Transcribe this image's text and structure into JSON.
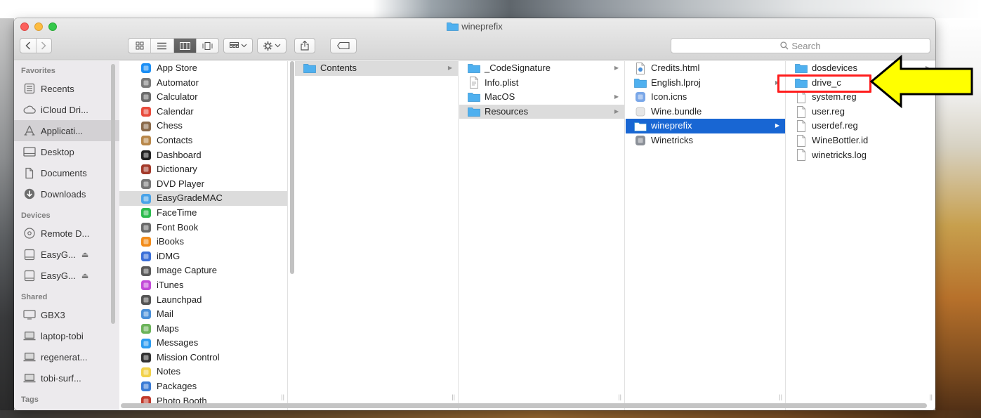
{
  "window": {
    "title": "wineprefix"
  },
  "toolbar": {
    "search_placeholder": "Search"
  },
  "sidebar": {
    "sections": {
      "favorites": "Favorites",
      "devices": "Devices",
      "shared": "Shared",
      "tags": "Tags"
    },
    "favorites": [
      {
        "label": "Recents",
        "icon": "recents-icon"
      },
      {
        "label": "iCloud Dri...",
        "icon": "cloud-icon"
      },
      {
        "label": "Applicati...",
        "icon": "applications-icon",
        "selected": true
      },
      {
        "label": "Desktop",
        "icon": "desktop-icon"
      },
      {
        "label": "Documents",
        "icon": "documents-icon"
      },
      {
        "label": "Downloads",
        "icon": "downloads-icon"
      }
    ],
    "devices": [
      {
        "label": "Remote D...",
        "icon": "remote-disc-icon"
      },
      {
        "label": "EasyG...",
        "icon": "disk-icon",
        "eject": "⏏"
      },
      {
        "label": "EasyG...",
        "icon": "disk-icon",
        "eject": "⏏"
      }
    ],
    "shared": [
      {
        "label": "GBX3",
        "icon": "display-icon"
      },
      {
        "label": "laptop-tobi",
        "icon": "computer-icon"
      },
      {
        "label": "regenerat...",
        "icon": "computer-icon"
      },
      {
        "label": "tobi-surf...",
        "icon": "computer-icon"
      }
    ]
  },
  "columns": {
    "applications": [
      {
        "label": "App Store",
        "icon_color": "#1c8ff5"
      },
      {
        "label": "Automator",
        "icon_color": "#7a7a7a"
      },
      {
        "label": "Calculator",
        "icon_color": "#6b6b6b"
      },
      {
        "label": "Calendar",
        "icon_color": "#e84b3c"
      },
      {
        "label": "Chess",
        "icon_color": "#8a6a4a"
      },
      {
        "label": "Contacts",
        "icon_color": "#b8874a"
      },
      {
        "label": "Dashboard",
        "icon_color": "#222222"
      },
      {
        "label": "Dictionary",
        "icon_color": "#a33a2a"
      },
      {
        "label": "DVD Player",
        "icon_color": "#777777"
      },
      {
        "label": "EasyGradeMAC",
        "icon_color": "#4aa3e8",
        "selected": true
      },
      {
        "label": "FaceTime",
        "icon_color": "#2dbb4e"
      },
      {
        "label": "Font Book",
        "icon_color": "#6a6a6a"
      },
      {
        "label": "iBooks",
        "icon_color": "#f28c1b"
      },
      {
        "label": "iDMG",
        "icon_color": "#3b6fd8"
      },
      {
        "label": "Image Capture",
        "icon_color": "#5a5a5a"
      },
      {
        "label": "iTunes",
        "icon_color": "#c34bd8"
      },
      {
        "label": "Launchpad",
        "icon_color": "#555555"
      },
      {
        "label": "Mail",
        "icon_color": "#4a90d9"
      },
      {
        "label": "Maps",
        "icon_color": "#6bb35a"
      },
      {
        "label": "Messages",
        "icon_color": "#2d9cf0"
      },
      {
        "label": "Mission Control",
        "icon_color": "#333333"
      },
      {
        "label": "Notes",
        "icon_color": "#f2d24a"
      },
      {
        "label": "Packages",
        "icon_color": "#3a7bd5"
      },
      {
        "label": "Photo Booth",
        "icon_color": "#c0392b"
      }
    ],
    "app_contents": [
      {
        "label": "Contents",
        "type": "folder",
        "selected": true,
        "has_children": true
      }
    ],
    "contents": [
      {
        "label": "_CodeSignature",
        "type": "folder",
        "has_children": true
      },
      {
        "label": "Info.plist",
        "type": "plist"
      },
      {
        "label": "MacOS",
        "type": "folder",
        "has_children": true
      },
      {
        "label": "Resources",
        "type": "folder",
        "selected": true,
        "has_children": true
      }
    ],
    "resources": [
      {
        "label": "Credits.html",
        "type": "html"
      },
      {
        "label": "English.lproj",
        "type": "folder",
        "has_children": true
      },
      {
        "label": "Icon.icns",
        "type": "icns"
      },
      {
        "label": "Wine.bundle",
        "type": "bundle"
      },
      {
        "label": "wineprefix",
        "type": "folder",
        "selected_blue": true,
        "has_children": true
      },
      {
        "label": "Winetricks",
        "type": "app"
      }
    ],
    "wineprefix": [
      {
        "label": "dosdevices",
        "type": "folder",
        "has_children": true
      },
      {
        "label": "drive_c",
        "type": "folder",
        "highlighted": true
      },
      {
        "label": "system.reg",
        "type": "file"
      },
      {
        "label": "user.reg",
        "type": "file"
      },
      {
        "label": "userdef.reg",
        "type": "file"
      },
      {
        "label": "WineBottler.id",
        "type": "file"
      },
      {
        "label": "winetricks.log",
        "type": "file"
      }
    ]
  },
  "colors": {
    "selection_blue": "#1866d3",
    "selection_grey": "#dcdcdc",
    "folder_blue": "#4fb0ef",
    "highlight_red": "#ff1c1c",
    "arrow_yellow": "#ffff00"
  }
}
